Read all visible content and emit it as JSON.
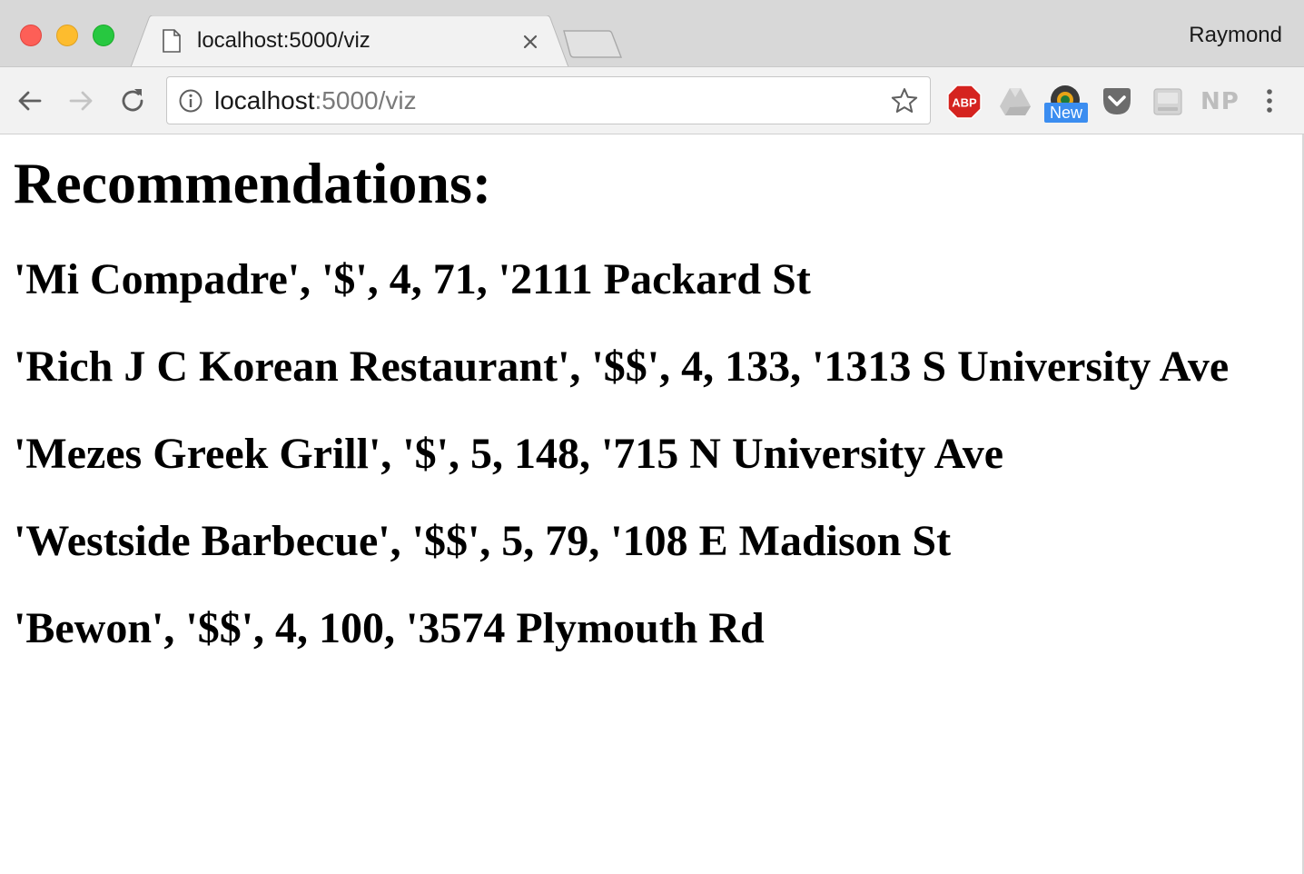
{
  "browser": {
    "tab": {
      "title": "localhost:5000/viz"
    },
    "profile_name": "Raymond",
    "address_bar": {
      "host": "localhost",
      "path": ":5000/viz"
    },
    "extensions": {
      "new_badge": "New",
      "np_label": "NP",
      "icons": [
        "abp-icon",
        "google-drive-icon",
        "camera-extension-icon",
        "pocket-icon",
        "disk-icon",
        "np-icon"
      ]
    },
    "colors": {
      "close": "#fd5f57",
      "minimize": "#fdbc2e",
      "maximize": "#27c840",
      "badge": "#3b8df0",
      "abp": "#d5231f"
    }
  },
  "page": {
    "heading": "Recommendations:",
    "recommendations": [
      "'Mi Compadre', '$', 4, 71, '2111 Packard St",
      "'Rich J C Korean Restaurant', '$$', 4, 133, '1313 S University Ave",
      "'Mezes Greek Grill', '$', 5, 148, '715 N University Ave",
      "'Westside Barbecue', '$$', 5, 79, '108 E Madison St",
      "'Bewon', '$$', 4, 100, '3574 Plymouth Rd"
    ]
  }
}
